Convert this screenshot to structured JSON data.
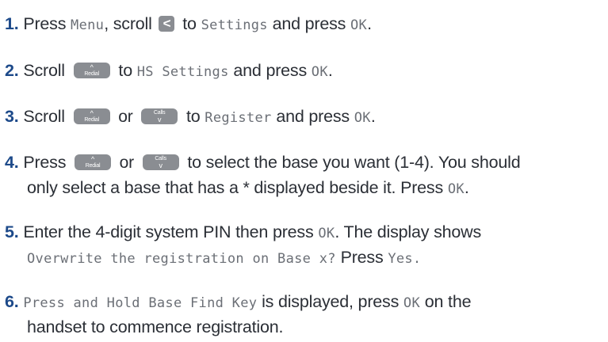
{
  "steps": [
    {
      "num": "1.",
      "t1": "Press ",
      "lcd1": "Menu",
      "t2": ", scroll ",
      "t3": " to ",
      "lcd2": "Settings",
      "t4": " and press ",
      "lcd3": "OK",
      "t5": "."
    },
    {
      "num": "2.",
      "t1": "Scroll ",
      "t2": " to ",
      "lcd1": "HS Settings",
      "t3": " and press ",
      "lcd2": "OK",
      "t4": "."
    },
    {
      "num": "3.",
      "t1": "Scroll ",
      "t2": " or ",
      "t3": " to ",
      "lcd1": "Register",
      "t4": " and press ",
      "lcd2": "OK",
      "t5": "."
    },
    {
      "num": "4.",
      "t1": "Press ",
      "t2": " or ",
      "t3": " to select the base you want (1-4). You should",
      "line2a": "only select a base that has a ",
      "star": "*",
      "line2b": " displayed beside it. Press ",
      "lcd1": "OK",
      "t4": "."
    },
    {
      "num": "5.",
      "t1": "Enter the 4-digit system PIN then press ",
      "lcd1": "OK",
      "t2": ". The display shows",
      "lcd2": "Overwrite the registration on Base x?",
      "t3": " Press ",
      "lcd3": "Yes."
    },
    {
      "num": "6.",
      "lcd1": "Press and Hold Base Find Key",
      "t1": " is displayed, press ",
      "lcd2": "OK",
      "t2": " on the",
      "line2": "handset to commence registration."
    }
  ],
  "keys": {
    "left": "<",
    "redial_label": "Redial",
    "calls_label": "Calls",
    "up_arrow": "^",
    "down_arrow": "v"
  }
}
